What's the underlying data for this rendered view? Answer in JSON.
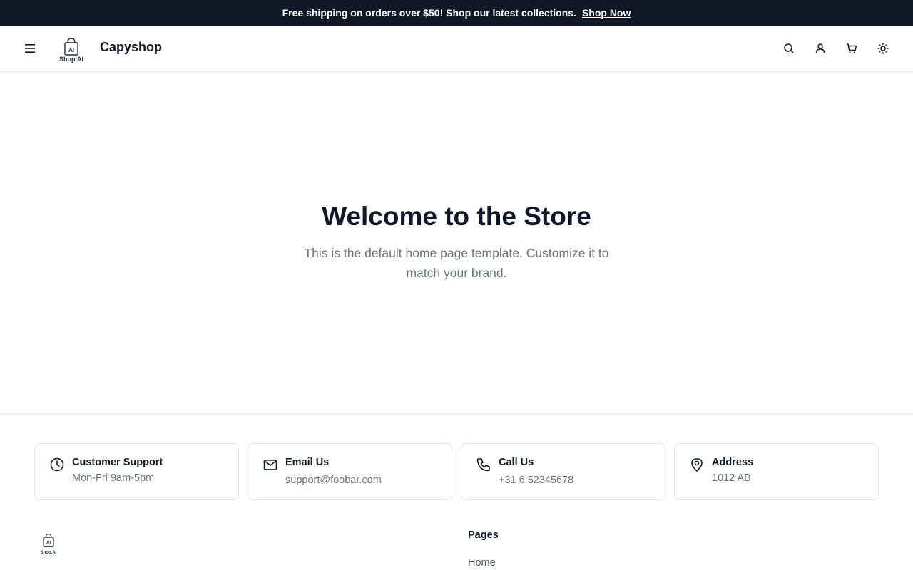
{
  "announcement": {
    "text": "Free shipping on orders over $50! Shop our latest collections.",
    "link_label": "Shop Now"
  },
  "header": {
    "brand_name": "Capyshop",
    "logo_caption": "Shop.AI",
    "icons": [
      "menu-icon",
      "search-icon",
      "user-icon",
      "cart-icon",
      "sun-icon"
    ]
  },
  "hero": {
    "title": "Welcome to the Store",
    "subtitle": "This is the default home page template. Customize it to match your brand."
  },
  "info_cards": [
    {
      "icon": "clock-icon",
      "title": "Customer Support",
      "value": "Mon-Fri 9am-5pm"
    },
    {
      "icon": "mail-icon",
      "title": "Email Us",
      "value": "support@foobar.com"
    },
    {
      "icon": "phone-icon",
      "title": "Call Us",
      "value": "+31 6 52345678"
    },
    {
      "icon": "map-pin-icon",
      "title": "Address",
      "value": "1012 AB"
    }
  ],
  "footer": {
    "logo_caption": "Shop.AI",
    "pages_heading": "Pages",
    "pages_links": [
      "Home"
    ]
  },
  "colors": {
    "announcement_bg": "#111827",
    "text_primary": "#0f172a",
    "text_muted": "#6b7280",
    "border": "#e5e7eb"
  }
}
